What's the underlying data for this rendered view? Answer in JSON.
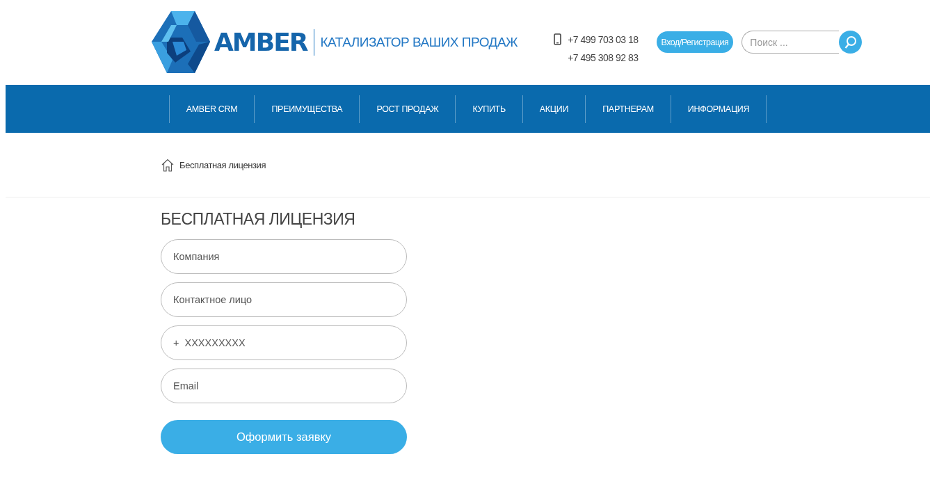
{
  "header": {
    "logo_text": "AMBER",
    "tagline": "КАТАЛИЗАТОР ВАШИХ ПРОДАЖ",
    "phones": [
      "+7 499 703 03 18",
      "+7 495 308 92 83"
    ],
    "login_button": "Вход/Регистрация",
    "search": {
      "placeholder": "Поиск ..."
    }
  },
  "nav": {
    "items": [
      {
        "label": "AMBER CRM"
      },
      {
        "label": "ПРЕИМУЩЕСТВА"
      },
      {
        "label": "РОСТ ПРОДАЖ"
      },
      {
        "label": "КУПИТЬ"
      },
      {
        "label": "АКЦИИ"
      },
      {
        "label": "ПАРТНЕРАМ"
      },
      {
        "label": "ИНФОРМАЦИЯ"
      }
    ]
  },
  "breadcrumb": {
    "current": "Бесплатная лицензия"
  },
  "form": {
    "title": "БЕСПЛАТНАЯ ЛИЦЕНЗИЯ",
    "fields": [
      {
        "placeholder": "Компания"
      },
      {
        "placeholder": "Контактное лицо"
      },
      {
        "placeholder": "+  XXXXXXXXX"
      },
      {
        "placeholder": "Email"
      }
    ],
    "submit": "Оформить заявку"
  }
}
